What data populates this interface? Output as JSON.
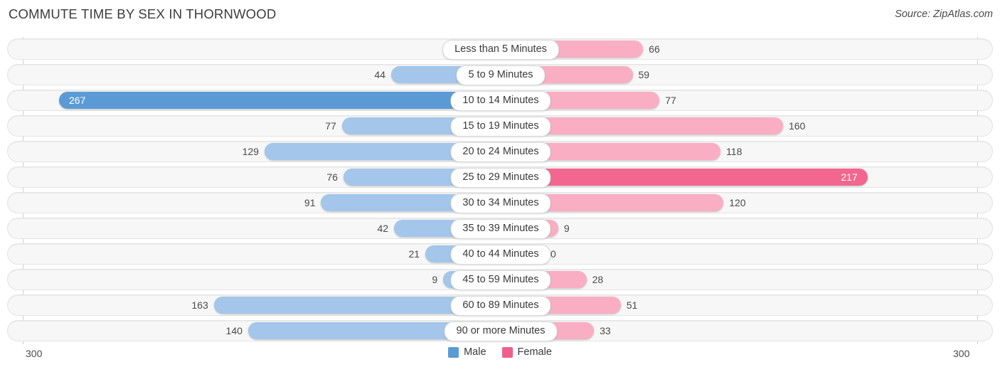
{
  "header": {
    "title": "COMMUTE TIME BY SEX IN THORNWOOD",
    "source": "Source: ZipAtlas.com"
  },
  "axis": {
    "left_label": "300",
    "right_label": "300"
  },
  "legend": {
    "items": [
      {
        "label": "Male",
        "color": "#5b9bd5"
      },
      {
        "label": "Female",
        "color": "#ef5f8c"
      }
    ]
  },
  "colors": {
    "male_light": "#a3c6ea",
    "male_dark": "#5b9bd5",
    "female_light": "#f9aec4",
    "female_dark": "#f2668f",
    "track": "#f7f7f7",
    "track_border": "#e4e4e4"
  },
  "chart_data": {
    "type": "bar",
    "title": "COMMUTE TIME BY SEX IN THORNWOOD",
    "subtitle": "Source: ZipAtlas.com",
    "orientation": "horizontal-diverging",
    "xlabel": "",
    "ylabel": "",
    "xlim": [
      300,
      300
    ],
    "grid": false,
    "legend_position": "bottom-center",
    "categories": [
      "Less than 5 Minutes",
      "5 to 9 Minutes",
      "10 to 14 Minutes",
      "15 to 19 Minutes",
      "20 to 24 Minutes",
      "25 to 29 Minutes",
      "30 to 34 Minutes",
      "35 to 39 Minutes",
      "40 to 44 Minutes",
      "45 to 59 Minutes",
      "60 to 89 Minutes",
      "90 or more Minutes"
    ],
    "series": [
      {
        "name": "Male",
        "values": [
          0,
          44,
          267,
          77,
          129,
          76,
          91,
          42,
          21,
          9,
          163,
          140
        ]
      },
      {
        "name": "Female",
        "values": [
          66,
          59,
          77,
          160,
          118,
          217,
          120,
          9,
          0,
          28,
          51,
          33
        ]
      }
    ]
  },
  "rows": [
    {
      "label": "Less than 5 Minutes",
      "male": "0",
      "female": "66"
    },
    {
      "label": "5 to 9 Minutes",
      "male": "44",
      "female": "59"
    },
    {
      "label": "10 to 14 Minutes",
      "male": "267",
      "female": "77"
    },
    {
      "label": "15 to 19 Minutes",
      "male": "77",
      "female": "160"
    },
    {
      "label": "20 to 24 Minutes",
      "male": "129",
      "female": "118"
    },
    {
      "label": "25 to 29 Minutes",
      "male": "76",
      "female": "217"
    },
    {
      "label": "30 to 34 Minutes",
      "male": "91",
      "female": "120"
    },
    {
      "label": "35 to 39 Minutes",
      "male": "42",
      "female": "9"
    },
    {
      "label": "40 to 44 Minutes",
      "male": "21",
      "female": "0"
    },
    {
      "label": "45 to 59 Minutes",
      "male": "9",
      "female": "28"
    },
    {
      "label": "60 to 89 Minutes",
      "male": "163",
      "female": "51"
    },
    {
      "label": "90 or more Minutes",
      "male": "140",
      "female": "33"
    }
  ]
}
